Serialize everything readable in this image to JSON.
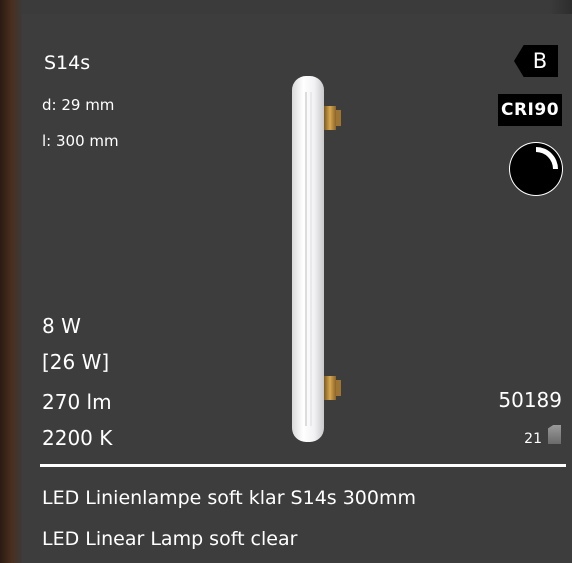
{
  "product": {
    "base": "S14s",
    "dimensions": {
      "diameter": "d: 29 mm",
      "length": "l:  300 mm"
    },
    "specs": {
      "power": "8 W",
      "equivalent": "[26 W]",
      "lumen": "270 lm",
      "color_temp": "2200 K"
    },
    "article_number": "50189",
    "pack_count": "21",
    "energy_class": "B",
    "cri": "CRI90",
    "dimmable_icon": "dimmable-icon",
    "name_de": "LED Linienlampe soft klar S14s 300mm",
    "name_en": "LED Linear Lamp soft clear"
  },
  "colors": {
    "background": "#3d3d3d",
    "text": "#ffffff",
    "badge": "#000000",
    "cap_metal": "#b8883c"
  }
}
